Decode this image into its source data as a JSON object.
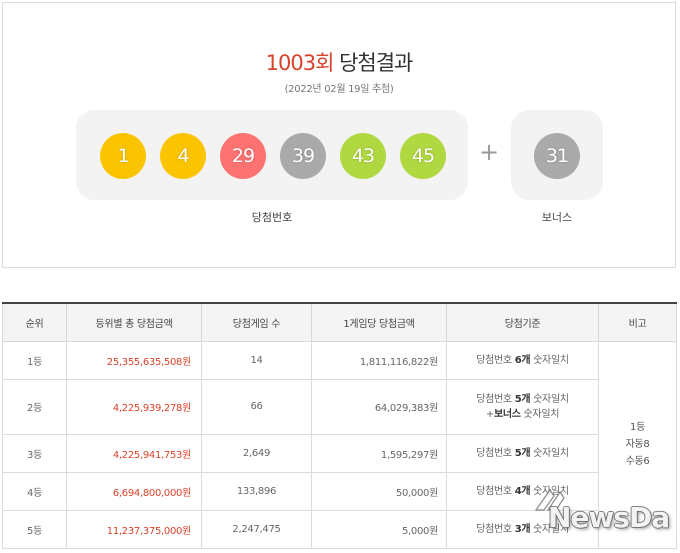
{
  "header": {
    "round": "1003회",
    "title": "당첨결과",
    "draw_date": "(2022년 02월 19일 추첨)"
  },
  "numbers": [
    {
      "value": "1",
      "color": "#fbc400"
    },
    {
      "value": "4",
      "color": "#fbc400"
    },
    {
      "value": "29",
      "color": "#ff7272"
    },
    {
      "value": "39",
      "color": "#aaaaaa"
    },
    {
      "value": "43",
      "color": "#b0d840"
    },
    {
      "value": "45",
      "color": "#b0d840"
    }
  ],
  "plus": "+",
  "bonus": {
    "value": "31",
    "color": "#aaaaaa"
  },
  "labels": {
    "winning": "당첨번호",
    "bonus": "보너스"
  },
  "table": {
    "headers": [
      "순위",
      "등위별 총 당첨금액",
      "당첨게임 수",
      "1게임당 당첨금액",
      "당첨기준",
      "비고"
    ],
    "rows": [
      {
        "rank": "1등",
        "total": "25,355,635,508원",
        "games": "14",
        "per_game": "1,811,116,822원",
        "crit_a": "당첨번호 ",
        "crit_b": "6개",
        "crit_c": " 숫자일치",
        "crit2_a": "",
        "crit2_b": "",
        "crit2_c": ""
      },
      {
        "rank": "2등",
        "total": "4,225,939,278원",
        "games": "66",
        "per_game": "64,029,383원",
        "crit_a": "당첨번호 ",
        "crit_b": "5개",
        "crit_c": " 숫자일치",
        "crit2_a": "+",
        "crit2_b": "보너스",
        "crit2_c": " 숫자일치"
      },
      {
        "rank": "3등",
        "total": "4,225,941,753원",
        "games": "2,649",
        "per_game": "1,595,297원",
        "crit_a": "당첨번호 ",
        "crit_b": "5개",
        "crit_c": " 숫자일치",
        "crit2_a": "",
        "crit2_b": "",
        "crit2_c": ""
      },
      {
        "rank": "4등",
        "total": "6,694,800,000원",
        "games": "133,896",
        "per_game": "50,000원",
        "crit_a": "당첨번호 ",
        "crit_b": "4개",
        "crit_c": " 숫자일치",
        "crit2_a": "",
        "crit2_b": "",
        "crit2_c": ""
      },
      {
        "rank": "5등",
        "total": "11,237,375,000원",
        "games": "2,247,475",
        "per_game": "5,000원",
        "crit_a": "당첨번호 ",
        "crit_b": "3개",
        "crit_c": " 숫자일치",
        "crit2_a": "",
        "crit2_b": "",
        "crit2_c": ""
      }
    ],
    "note": [
      "1등",
      "자동8",
      "수동6"
    ]
  },
  "watermark": "NewsDa"
}
